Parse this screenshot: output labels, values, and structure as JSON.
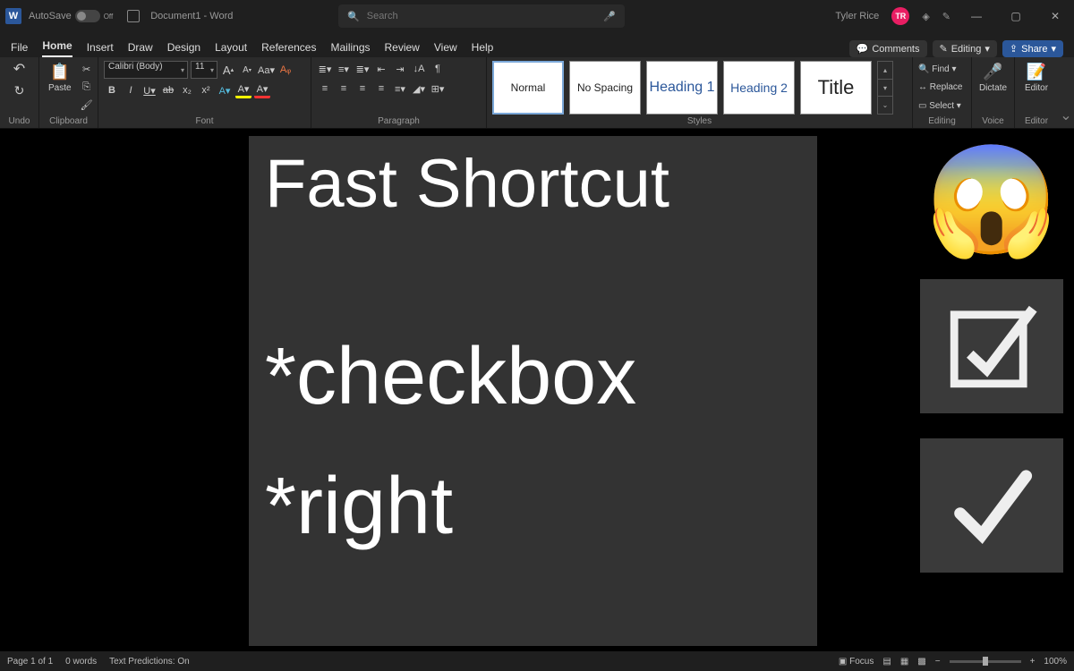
{
  "titlebar": {
    "autosave_label": "AutoSave",
    "autosave_state": "Off",
    "doc_title": "Document1 - Word",
    "search_placeholder": "Search",
    "user_name": "Tyler Rice",
    "user_initials": "TR"
  },
  "tabs": {
    "items": [
      "File",
      "Home",
      "Insert",
      "Draw",
      "Design",
      "Layout",
      "References",
      "Mailings",
      "Review",
      "View",
      "Help"
    ],
    "active": "Home",
    "comments": "Comments",
    "editing": "Editing",
    "share": "Share"
  },
  "ribbon": {
    "undo_label": "Undo",
    "clipboard": {
      "paste": "Paste",
      "label": "Clipboard"
    },
    "font": {
      "name": "Calibri (Body)",
      "size": "11",
      "label": "Font",
      "increase": "A",
      "decrease": "A",
      "case": "Aa",
      "clear": "A",
      "bold": "B",
      "italic": "I",
      "underline": "U",
      "strike": "ab",
      "sub": "x",
      "sup": "x",
      "hl": "A",
      "fc": "A"
    },
    "paragraph": {
      "label": "Paragraph"
    },
    "styles": {
      "label": "Styles",
      "items": [
        {
          "label": "Normal",
          "cls": "sel"
        },
        {
          "label": "No Spacing",
          "cls": ""
        },
        {
          "label": "Heading 1",
          "cls": "h1"
        },
        {
          "label": "Heading 2",
          "cls": "h2"
        },
        {
          "label": "Title",
          "cls": "title"
        }
      ]
    },
    "editing": {
      "find": "Find",
      "replace": "Replace",
      "select": "Select",
      "label": "Editing"
    },
    "voice": {
      "dictate": "Dictate",
      "label": "Voice"
    },
    "editor": {
      "editor": "Editor",
      "label": "Editor"
    }
  },
  "document": {
    "line1": "Fast Shortcut",
    "line2": "*checkbox",
    "line3": "*right"
  },
  "status": {
    "page": "Page 1 of 1",
    "words": "0 words",
    "predictions": "Text Predictions: On",
    "focus": "Focus",
    "zoom": "100%"
  }
}
